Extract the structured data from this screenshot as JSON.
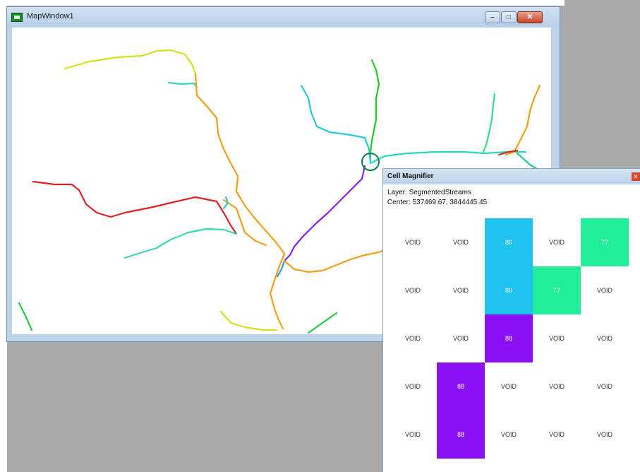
{
  "map_window": {
    "title": "MapWindow1",
    "buttons": {
      "minimize": "–",
      "maximize": "□",
      "close": "✕"
    },
    "icon": "map-window-icon"
  },
  "magnifier": {
    "title": "Cell Magnifier",
    "close": "✕",
    "layer_line": "Layer: SegmentedStreams",
    "center_line": "Center: 537469.67, 3844445.45",
    "grid": [
      [
        "VOID",
        "VOID",
        "86",
        "VOID",
        "77"
      ],
      [
        "VOID",
        "VOID",
        "86",
        "77",
        "VOID"
      ],
      [
        "VOID",
        "VOID",
        "88",
        "VOID",
        "VOID"
      ],
      [
        "VOID",
        "88",
        "VOID",
        "VOID",
        "VOID"
      ],
      [
        "VOID",
        "88",
        "VOID",
        "VOID",
        "VOID"
      ]
    ],
    "value_colors": {
      "86": "#1ec2ee",
      "77": "#22ee9a",
      "88": "#8a10f6"
    }
  }
}
